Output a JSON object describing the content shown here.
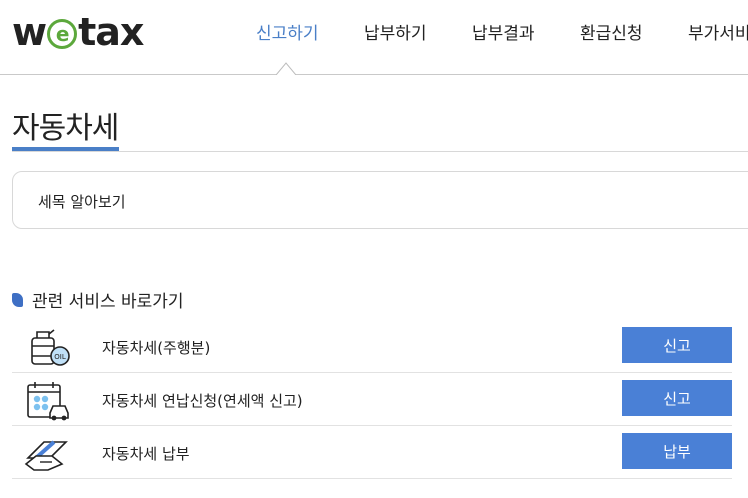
{
  "header": {
    "logo": {
      "w": "w",
      "e": "e",
      "tax": "tax"
    },
    "nav": [
      "신고하기",
      "납부하기",
      "납부결과",
      "환급신청",
      "부가서비"
    ],
    "active_index": 0
  },
  "page": {
    "title": "자동차세"
  },
  "tax_info": {
    "label": "세목 알아보기"
  },
  "related": {
    "title": "관련 서비스 바로가기",
    "items": [
      {
        "label": "자동차세(주행분)",
        "button": "신고",
        "icon": "fuel-tank-oil-icon"
      },
      {
        "label": "자동차세 연납신청(연세액 신고)",
        "button": "신고",
        "icon": "calendar-car-icon"
      },
      {
        "label": "자동차세 납부",
        "button": "납부",
        "icon": "card-payment-icon"
      }
    ]
  },
  "colors": {
    "accent": "#4a7fc7",
    "button": "#4a80d6",
    "logo_green": "#5ca83c"
  }
}
